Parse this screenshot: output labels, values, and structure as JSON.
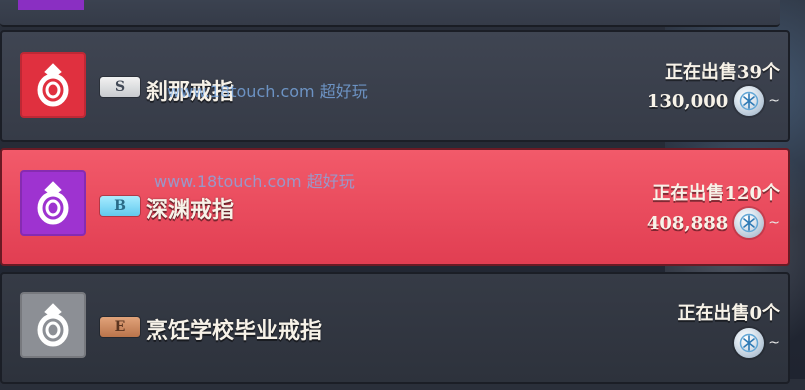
{
  "listings": [
    {
      "rank": "S",
      "name": "刹那戒指",
      "on_sale": "正在出售39个",
      "price": "130,000",
      "suffix": "~",
      "icon_name": "ring-icon",
      "icon_color": "#e0303f"
    },
    {
      "rank": "B",
      "name": "深渊戒指",
      "on_sale": "正在出售120个",
      "price": "408,888",
      "suffix": "~",
      "icon_name": "ring-icon",
      "icon_color": "#9e33d0",
      "selected": true
    },
    {
      "rank": "E",
      "name": "烹饪学校毕业戒指",
      "on_sale": "正在出售0个",
      "price": "",
      "suffix": "~",
      "icon_name": "ring-icon",
      "icon_color": "#8c8f95"
    }
  ],
  "watermark": {
    "site": "www.18touch.com",
    "slogan": "超好玩"
  },
  "theme": {
    "selected_row": "#e13e52",
    "rank_S": "#e8e8e8",
    "rank_B": "#7bd6f5",
    "rank_E": "#c58558"
  }
}
